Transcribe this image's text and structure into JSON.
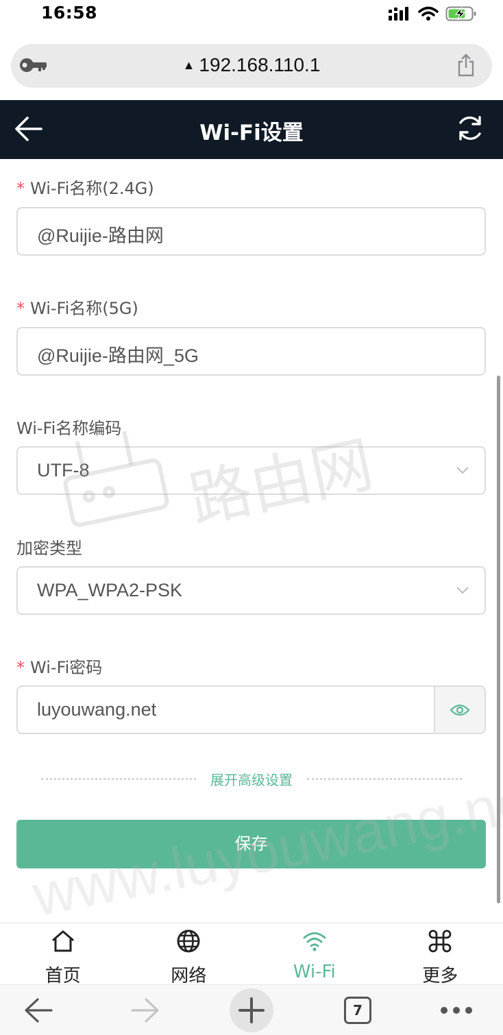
{
  "status_bar": {
    "time": "16:58"
  },
  "browser": {
    "url": "192.168.110.1"
  },
  "header": {
    "title": "Wi-Fi设置"
  },
  "form": {
    "ssid_24": {
      "label": "Wi-Fi名称(2.4G)",
      "required": "*",
      "value": "@Ruijie-路由网"
    },
    "ssid_5": {
      "label": "Wi-Fi名称(5G)",
      "required": "*",
      "value": "@Ruijie-路由网_5G"
    },
    "encoding": {
      "label": "Wi-Fi名称编码",
      "value": "UTF-8"
    },
    "encryption": {
      "label": "加密类型",
      "value": "WPA_WPA2-PSK"
    },
    "password": {
      "label": "Wi-Fi密码",
      "required": "*",
      "value": "luyouwang.net"
    }
  },
  "advanced_label": "展开高级设置",
  "save_label": "保存",
  "watermark": {
    "text": "www.luyouwang.net",
    "logo_text": "路由网"
  },
  "tabs": [
    {
      "label": "首页",
      "icon": "home-icon"
    },
    {
      "label": "网络",
      "icon": "globe-icon"
    },
    {
      "label": "Wi-Fi",
      "icon": "wifi-icon",
      "active": true
    },
    {
      "label": "更多",
      "icon": "command-icon"
    }
  ],
  "toolbar": {
    "tab_count": "7"
  },
  "colors": {
    "accent": "#5bb896",
    "header_bg": "#101a26",
    "required": "#e8505b"
  }
}
